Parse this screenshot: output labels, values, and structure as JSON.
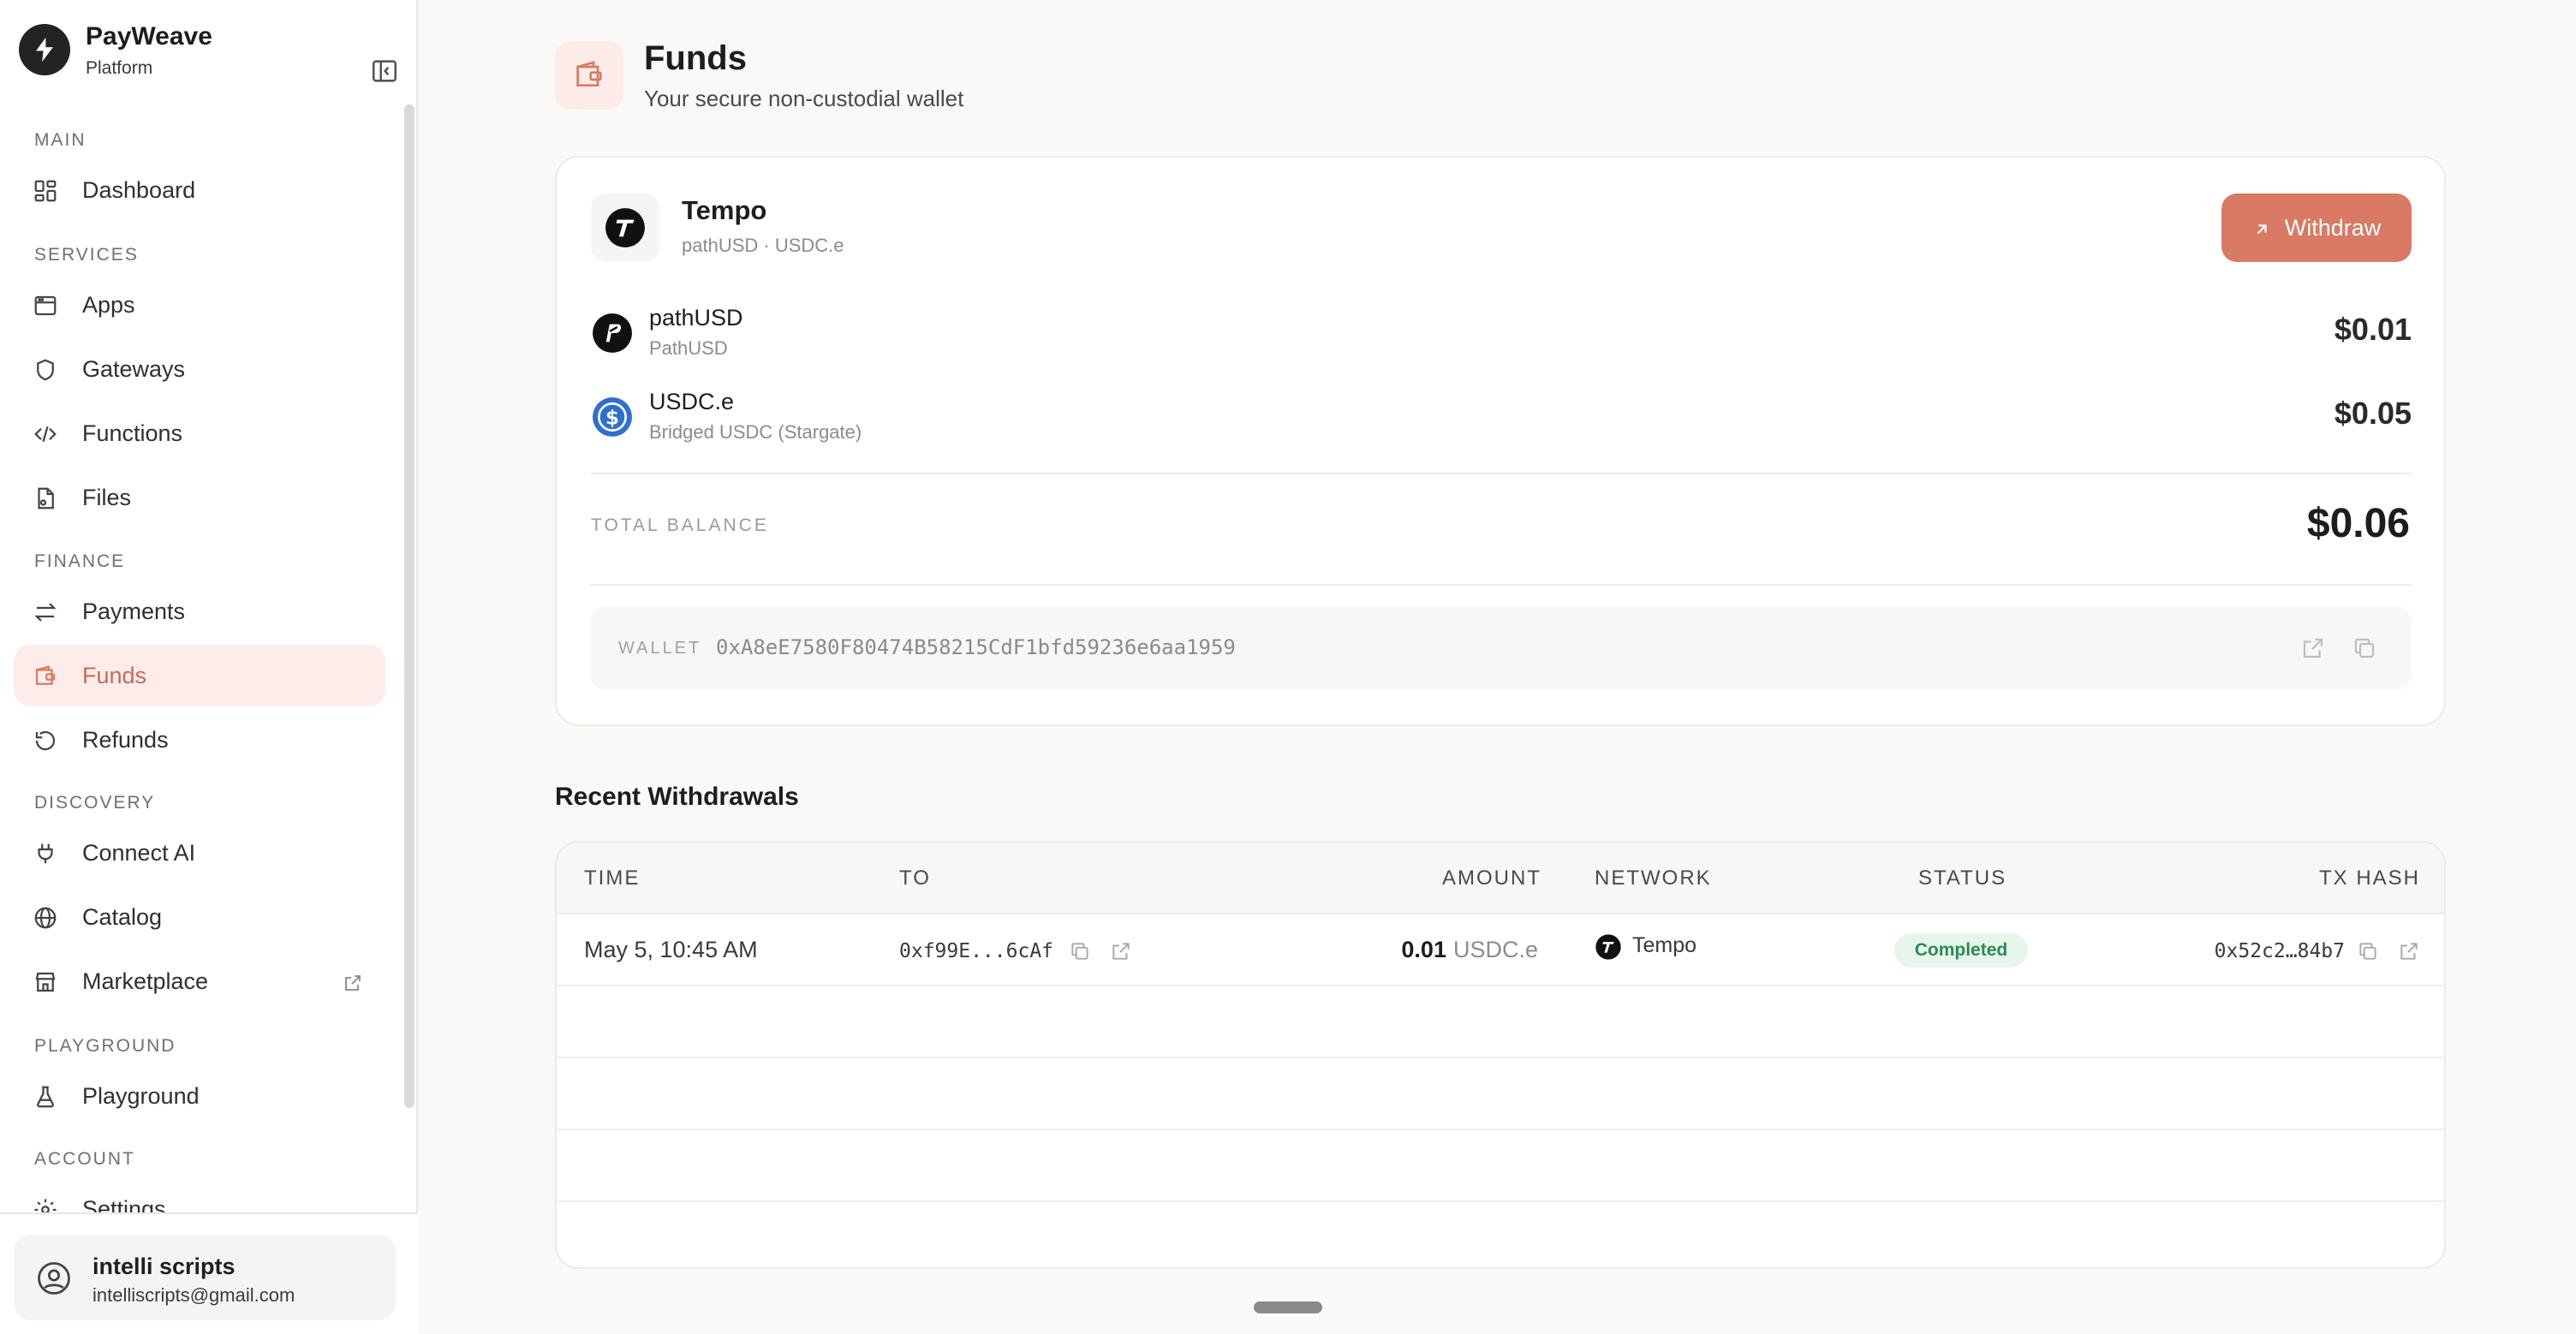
{
  "brand": {
    "name": "PayWeave",
    "subtitle": "Platform"
  },
  "nav": {
    "sections": {
      "main": "MAIN",
      "services": "SERVICES",
      "finance": "FINANCE",
      "discovery": "DISCOVERY",
      "playground": "PLAYGROUND",
      "account": "ACCOUNT"
    },
    "items": {
      "dashboard": "Dashboard",
      "apps": "Apps",
      "gateways": "Gateways",
      "functions": "Functions",
      "files": "Files",
      "payments": "Payments",
      "funds": "Funds",
      "refunds": "Refunds",
      "connect_ai": "Connect AI",
      "catalog": "Catalog",
      "marketplace": "Marketplace",
      "playground": "Playground",
      "settings": "Settings"
    },
    "active": "funds"
  },
  "user": {
    "name": "intelli scripts",
    "email": "intelliscripts@gmail.com"
  },
  "page": {
    "title": "Funds",
    "subtitle": "Your secure non-custodial wallet"
  },
  "network_card": {
    "name": "Tempo",
    "tokens_line": "pathUSD · USDC.e",
    "withdraw_label": "Withdraw",
    "tokens": [
      {
        "symbol": "pathUSD",
        "name": "PathUSD",
        "amount": "$0.01"
      },
      {
        "symbol": "USDC.e",
        "name": "Bridged USDC (Stargate)",
        "amount": "$0.05"
      }
    ],
    "total_label": "TOTAL BALANCE",
    "total_value": "$0.06",
    "wallet_label": "WALLET",
    "wallet_address": "0xA8eE7580F80474B58215CdF1bfd59236e6aa1959"
  },
  "withdrawals": {
    "title": "Recent Withdrawals",
    "columns": {
      "time": "TIME",
      "to": "TO",
      "amount": "AMOUNT",
      "network": "NETWORK",
      "status": "STATUS",
      "tx_hash": "TX HASH"
    },
    "rows": [
      {
        "time": "May 5, 10:45 AM",
        "to": "0xf99E...6cAf",
        "amount": "0.01",
        "currency": "USDC.e",
        "network": "Tempo",
        "status": "Completed",
        "tx_hash": "0x52c2…84b7"
      }
    ]
  },
  "colors": {
    "accent": "#d87a64",
    "active_bg": "#fdecea",
    "success": "#2c8a4e",
    "usdc_blue": "#2f6fd0"
  }
}
